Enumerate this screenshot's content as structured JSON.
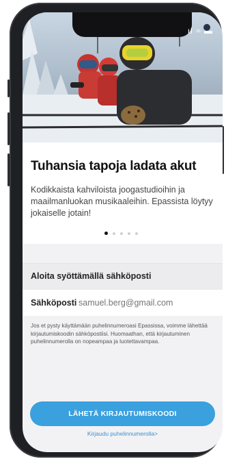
{
  "status_bar": {
    "signal": "ıl",
    "wifi": "≈",
    "battery": "▬"
  },
  "onboarding": {
    "title": "Tuhansia tapoja ladata akut",
    "description": "Kodikkaista kahviloista joogastudioihin ja maailmanluokan musikaaleihin. Epassista löytyy jokaiselle jotain!",
    "carousel": {
      "pages": 5,
      "active_index": 0
    }
  },
  "login": {
    "section_title": "Aloita syöttämällä sähköposti",
    "email_label": "Sähköposti",
    "email_placeholder": "samuel.berg@gmail.com",
    "info_text": "Jos et pysty käyttämään puhelinnumeroasi Epassissa, voimme lähettää kirjautumiskoodin sähköpostiisi. Huomaathan, että kirjautuminen puhelinnumerolla on nopeampaa ja luotettavampaa.",
    "submit_label": "LÄHETÄ KIRJAUTUMISKOODI",
    "alt_link": "Kirjaudu puhelinnumerolla>"
  },
  "colors": {
    "accent": "#3aa0de",
    "link": "#3a8fd0",
    "section_bg": "#ececee"
  }
}
